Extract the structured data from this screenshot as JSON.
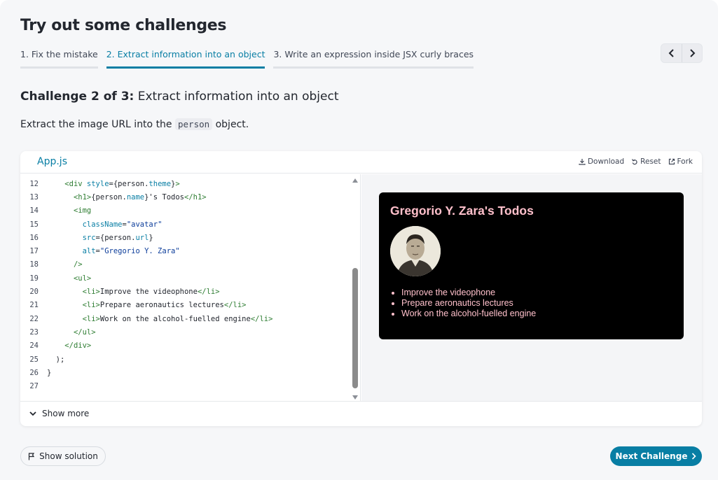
{
  "header": {
    "title": "Try out some challenges"
  },
  "tabs": [
    {
      "label": "1. Fix the mistake",
      "active": false
    },
    {
      "label": "2. Extract information into an object",
      "active": true
    },
    {
      "label": "3. Write an expression inside JSX curly braces",
      "active": false
    }
  ],
  "nav": {
    "prev_icon": "chevron-left-icon",
    "next_icon": "chevron-right-icon"
  },
  "challenge": {
    "counter": "Challenge 2 of 3:",
    "name": "Extract information into an object",
    "description_pre": "Extract the image URL into the",
    "description_code": "person",
    "description_post": "object."
  },
  "sandbox": {
    "file_tab": "App.js",
    "actions": {
      "download": "Download",
      "reset": "Reset",
      "fork": "Fork"
    },
    "code_lines": [
      {
        "n": "12",
        "indent": "    ",
        "tokens": [
          [
            "tg",
            "<div "
          ],
          [
            "at",
            "style"
          ],
          [
            "code",
            "={person."
          ],
          [
            "pr",
            "theme"
          ],
          [
            "code",
            "}"
          ],
          [
            "tg",
            ">"
          ]
        ]
      },
      {
        "n": "13",
        "indent": "      ",
        "tokens": [
          [
            "tg",
            "<h1>"
          ],
          [
            "code",
            "{person."
          ],
          [
            "pr",
            "name"
          ],
          [
            "code",
            "}'s Todos"
          ],
          [
            "tg",
            "</h1>"
          ]
        ]
      },
      {
        "n": "14",
        "indent": "      ",
        "tokens": [
          [
            "tg",
            "<img"
          ]
        ]
      },
      {
        "n": "15",
        "indent": "        ",
        "tokens": [
          [
            "at",
            "className"
          ],
          [
            "code",
            "="
          ],
          [
            "str",
            "\"avatar\""
          ]
        ]
      },
      {
        "n": "16",
        "indent": "        ",
        "tokens": [
          [
            "at",
            "src"
          ],
          [
            "code",
            "={person."
          ],
          [
            "pr",
            "url"
          ],
          [
            "code",
            "}"
          ]
        ]
      },
      {
        "n": "17",
        "indent": "        ",
        "tokens": [
          [
            "at",
            "alt"
          ],
          [
            "code",
            "="
          ],
          [
            "str",
            "\"Gregorio Y. Zara\""
          ]
        ]
      },
      {
        "n": "18",
        "indent": "      ",
        "tokens": [
          [
            "tg",
            "/>"
          ]
        ]
      },
      {
        "n": "19",
        "indent": "      ",
        "tokens": [
          [
            "tg",
            "<ul>"
          ]
        ]
      },
      {
        "n": "20",
        "indent": "        ",
        "tokens": [
          [
            "tg",
            "<li>"
          ],
          [
            "code",
            "Improve the videophone"
          ],
          [
            "tg",
            "</li>"
          ]
        ]
      },
      {
        "n": "21",
        "indent": "        ",
        "tokens": [
          [
            "tg",
            "<li>"
          ],
          [
            "code",
            "Prepare aeronautics lectures"
          ],
          [
            "tg",
            "</li>"
          ]
        ]
      },
      {
        "n": "22",
        "indent": "        ",
        "tokens": [
          [
            "tg",
            "<li>"
          ],
          [
            "code",
            "Work on the alcohol-fuelled engine"
          ],
          [
            "tg",
            "</li>"
          ]
        ]
      },
      {
        "n": "23",
        "indent": "      ",
        "tokens": [
          [
            "tg",
            "</ul>"
          ]
        ]
      },
      {
        "n": "24",
        "indent": "    ",
        "tokens": [
          [
            "tg",
            "</div>"
          ]
        ]
      },
      {
        "n": "25",
        "indent": "  ",
        "tokens": [
          [
            "code",
            ");"
          ]
        ]
      },
      {
        "n": "26",
        "indent": "",
        "tokens": [
          [
            "code",
            "}"
          ]
        ]
      },
      {
        "n": "27",
        "indent": "",
        "tokens": []
      }
    ],
    "preview": {
      "title": "Gregorio Y. Zara's Todos",
      "todos": [
        "Improve the videophone",
        "Prepare aeronautics lectures",
        "Work on the alcohol-fuelled engine"
      ]
    },
    "show_more": "Show more"
  },
  "footer": {
    "show_solution": "Show solution",
    "next_challenge": "Next Challenge"
  },
  "colors": {
    "accent": "#087ea4",
    "preview_bg": "#000000",
    "preview_text": "#ffc0cb"
  }
}
